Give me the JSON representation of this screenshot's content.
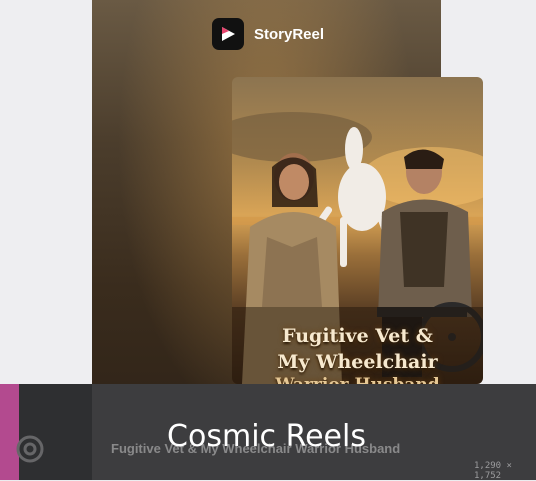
{
  "brand": {
    "name": "StoryReel",
    "logo_icon": "play-icon"
  },
  "poster": {
    "title_line1": "Fugitive Vet &",
    "title_line2": "My Wheelchair",
    "title_line3": "Warrior Husband"
  },
  "caption": "Cosmic Reels",
  "background_title": "Fugitive Vet & My Wheelchair Warrior Husband",
  "image_dimensions": "1,290 × 1,752",
  "colors": {
    "accent_strip": "#b34a8f",
    "bottom_bar": "#3d3d3f"
  }
}
